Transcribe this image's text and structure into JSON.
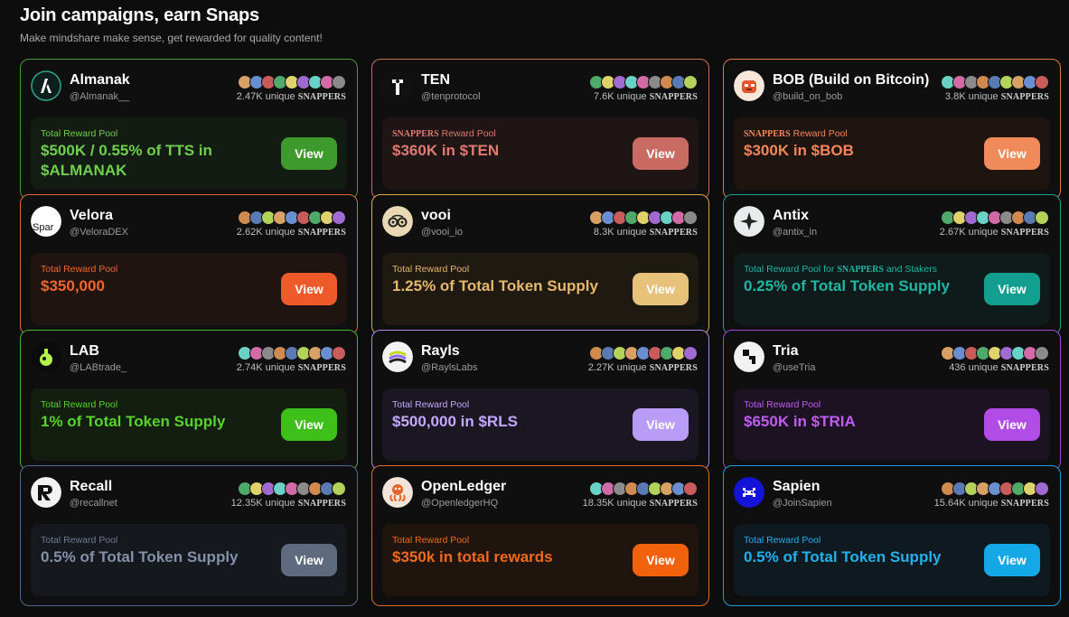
{
  "page": {
    "title": "Join campaigns, earn Snaps",
    "subtitle": "Make mindshare make sense, get rewarded for quality content!"
  },
  "snappers_word": "SNAPPERS",
  "unique_word": "unique",
  "campaigns": [
    {
      "name": "Almanak",
      "handle": "@Almanak__",
      "count": "2.47K",
      "pool_label": "Total Reward Pool",
      "pool_value": "$500K / 0.55% of TTS in $ALMANAK",
      "button": "View",
      "color": "#3f9a2e",
      "label_color": "#6fcf4f",
      "value_color": "#6fcf4f",
      "border": "#4a9a35",
      "pool_bg": "#131c12",
      "logo_icon": "almanak-logo-icon"
    },
    {
      "name": "TEN",
      "handle": "@tenprotocol",
      "count": "7.6K",
      "pool_label": "SNAPPERS Reward Pool",
      "pool_value": "$360K in $TEN",
      "button": "View",
      "color": "#c96a63",
      "label_color": "#e07a70",
      "value_color": "#e07a70",
      "border": "#c8714e",
      "pool_bg": "#1e1514",
      "logo_icon": "ten-logo-icon"
    },
    {
      "name": "BOB (Build on Bitcoin)",
      "handle": "@build_on_bob",
      "count": "3.8K",
      "pool_label": "SNAPPERS Reward Pool",
      "pool_value": "$300K in $BOB",
      "button": "View",
      "color": "#f08a5b",
      "label_color": "#f4855a",
      "value_color": "#f4855a",
      "border": "#e07a45",
      "pool_bg": "#1f1510",
      "logo_icon": "bob-logo-icon"
    },
    {
      "name": "Velora",
      "handle": "@VeloraDEX",
      "count": "2.62K",
      "pool_label": "Total Reward Pool",
      "pool_value": "$350,000",
      "button": "View",
      "color": "#ee5a2a",
      "label_color": "#f0662f",
      "value_color": "#f0662f",
      "border": "#e0683a",
      "pool_bg": "#1f1410",
      "logo_icon": "velora-logo-icon"
    },
    {
      "name": "vooi",
      "handle": "@vooi_io",
      "count": "8.3K",
      "pool_label": "Total Reward Pool",
      "pool_value": "1.25% of Total Token Supply",
      "button": "View",
      "color": "#e6c27a",
      "label_color": "#e8b86a",
      "value_color": "#e8b86a",
      "border": "#e0a64a",
      "pool_bg": "#1e1911",
      "logo_icon": "vooi-logo-icon"
    },
    {
      "name": "Antix",
      "handle": "@antix_in",
      "count": "2.67K",
      "pool_label": "Total Reward Pool for SNAPPERS and Stakers",
      "pool_value": "0.25% of Total Token Supply",
      "button": "View",
      "color": "#139f90",
      "label_color": "#1fb6a4",
      "value_color": "#1fb6a4",
      "border": "#1f9f92",
      "pool_bg": "#0f1b1a",
      "logo_icon": "antix-logo-icon"
    },
    {
      "name": "LAB",
      "handle": "@LABtrade_",
      "count": "2.74K",
      "pool_label": "Total Reward Pool",
      "pool_value": "1% of Total Token Supply",
      "button": "View",
      "color": "#3fbf1a",
      "label_color": "#55d42a",
      "value_color": "#55d42a",
      "border": "#46b52a",
      "pool_bg": "#131d10",
      "logo_icon": "lab-logo-icon"
    },
    {
      "name": "Rayls",
      "handle": "@RaylsLabs",
      "count": "2.27K",
      "pool_label": "Total Reward Pool",
      "pool_value": "$500,000 in $RLS",
      "button": "View",
      "color": "#b99cf5",
      "label_color": "#c4a8ff",
      "value_color": "#c4a8ff",
      "border": "#a98ae8",
      "pool_bg": "#1a1722",
      "logo_icon": "rayls-logo-icon"
    },
    {
      "name": "Tria",
      "handle": "@useTria",
      "count": "436",
      "pool_label": "Total Reward Pool",
      "pool_value": "$650K in $TRIA",
      "button": "View",
      "color": "#b24ce6",
      "label_color": "#c05cf2",
      "value_color": "#c05cf2",
      "border": "#a545d8",
      "pool_bg": "#1c1222",
      "logo_icon": "tria-logo-icon"
    },
    {
      "name": "Recall",
      "handle": "@recallnet",
      "count": "12.35K",
      "pool_label": "Total Reward Pool",
      "pool_value": "0.5% of Total Token Supply",
      "button": "View",
      "color": "#5e6b7f",
      "label_color": "#6d7b92",
      "value_color": "#8290a8",
      "border": "#4e6a8a",
      "pool_bg": "#15181d",
      "logo_icon": "recall-logo-icon"
    },
    {
      "name": "OpenLedger",
      "handle": "@OpenledgerHQ",
      "count": "18.35K",
      "pool_label": "Total Reward Pool",
      "pool_value": "$350k in total rewards",
      "button": "View",
      "color": "#f2610b",
      "label_color": "#f06a1a",
      "value_color": "#f06a1a",
      "border": "#e06a2a",
      "pool_bg": "#1f140e",
      "logo_icon": "openledger-logo-icon"
    },
    {
      "name": "Sapien",
      "handle": "@JoinSapien",
      "count": "15.64K",
      "pool_label": "Total Reward Pool",
      "pool_value": "0.5% of Total Token Supply",
      "button": "View",
      "color": "#14a8e6",
      "label_color": "#22b0ee",
      "value_color": "#22b0ee",
      "border": "#1e9ed6",
      "pool_bg": "#0f1a20",
      "logo_icon": "sapien-logo-icon"
    }
  ]
}
